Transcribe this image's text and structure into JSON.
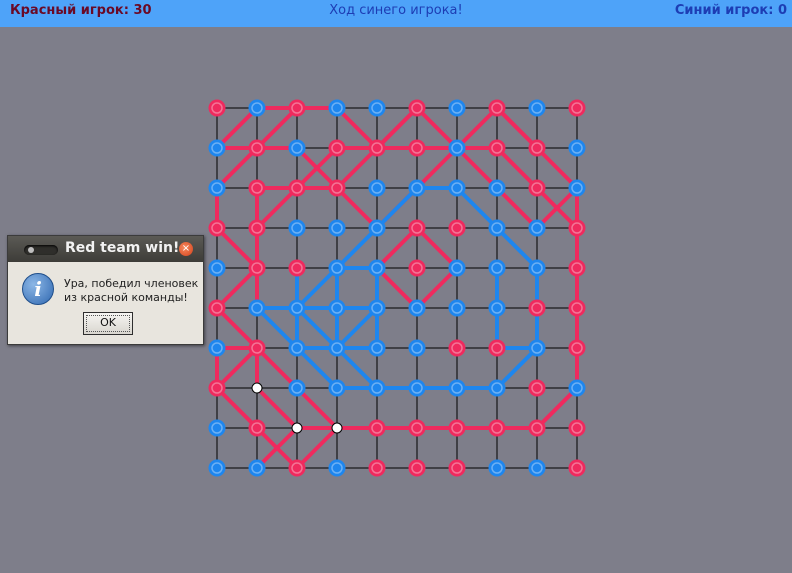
{
  "header": {
    "red_score": "Красный игрок: 30",
    "status": "Ход синего игрока!",
    "blue_score": "Синий игрок: 0"
  },
  "colors": {
    "red": "#ef2a5e",
    "blue": "#1e86ee",
    "grid": "#000000",
    "background": "#7e7e8a",
    "topbar": "#4ea3f9"
  },
  "board": {
    "size": 10,
    "dots": [
      "RBRBBRBRBR",
      "BRBRRRBRRB",
      "BRRRBBBBRB",
      "RRBBBRRBBR",
      "BRRBBRBBBR",
      "RBBBBBBBRR",
      "BRBBBBRRBR",
      "ROBBBBBBRB",
      "BRObRRRRRR",
      "BBRBRRRBBR"
    ],
    "red_lines": [
      [
        [
          0,
          1
        ],
        [
          1,
          0
        ],
        [
          2,
          0
        ],
        [
          3,
          0
        ],
        [
          4,
          1
        ],
        [
          5,
          0
        ],
        [
          6,
          1
        ],
        [
          7,
          0
        ],
        [
          8,
          1
        ]
      ],
      [
        [
          0,
          1
        ],
        [
          1,
          1
        ],
        [
          2,
          1
        ],
        [
          3,
          2
        ],
        [
          4,
          3
        ],
        [
          5,
          2
        ],
        [
          6,
          1
        ],
        [
          7,
          2
        ],
        [
          8,
          3
        ],
        [
          9,
          2
        ],
        [
          10,
          3
        ],
        [
          11,
          2
        ]
      ],
      [
        [
          1,
          3
        ],
        [
          2,
          2
        ],
        [
          3,
          1
        ],
        [
          4,
          1
        ],
        [
          5,
          1
        ],
        [
          6,
          1
        ],
        [
          7,
          1
        ],
        [
          8,
          2
        ],
        [
          9,
          3
        ]
      ],
      [
        [
          2,
          0
        ],
        [
          1,
          1
        ],
        [
          0,
          2
        ],
        [
          0,
          3
        ],
        [
          1,
          4
        ],
        [
          0,
          5
        ],
        [
          1,
          6
        ],
        [
          1,
          7
        ],
        [
          2,
          8
        ],
        [
          1,
          9
        ]
      ],
      [
        [
          4,
          1
        ],
        [
          3,
          2
        ],
        [
          2,
          2
        ],
        [
          1,
          2
        ]
      ],
      [
        [
          1,
          2
        ],
        [
          1,
          3
        ],
        [
          1,
          4
        ],
        [
          1,
          5
        ]
      ],
      [
        [
          5,
          0
        ],
        [
          4,
          1
        ]
      ],
      [
        [
          7,
          0
        ],
        [
          8,
          1
        ],
        [
          9,
          2
        ],
        [
          9,
          3
        ],
        [
          9,
          4
        ],
        [
          9,
          5
        ],
        [
          9,
          6
        ],
        [
          9,
          7
        ],
        [
          8,
          8
        ],
        [
          7,
          8
        ],
        [
          6,
          8
        ],
        [
          5,
          8
        ],
        [
          4,
          8
        ],
        [
          3,
          8
        ],
        [
          2,
          8
        ]
      ],
      [
        [
          5,
          3
        ],
        [
          4,
          4
        ],
        [
          5,
          5
        ],
        [
          6,
          4
        ],
        [
          5,
          3
        ]
      ],
      [
        [
          0,
          6
        ],
        [
          1,
          6
        ],
        [
          2,
          7
        ],
        [
          3,
          8
        ],
        [
          2,
          9
        ],
        [
          1,
          8
        ],
        [
          0,
          7
        ],
        [
          0,
          6
        ]
      ],
      [
        [
          1,
          6
        ],
        [
          0,
          7
        ]
      ],
      [
        [
          8,
          8
        ],
        [
          9,
          7
        ]
      ]
    ],
    "blue_lines": [
      [
        [
          5,
          2
        ],
        [
          6,
          2
        ],
        [
          7,
          3
        ],
        [
          8,
          4
        ],
        [
          8,
          5
        ],
        [
          8,
          6
        ],
        [
          7,
          7
        ],
        [
          6,
          7
        ],
        [
          5,
          7
        ],
        [
          4,
          7
        ],
        [
          3,
          6
        ],
        [
          2,
          5
        ],
        [
          3,
          4
        ],
        [
          4,
          3
        ],
        [
          5,
          2
        ]
      ],
      [
        [
          1,
          5
        ],
        [
          2,
          5
        ],
        [
          3,
          5
        ],
        [
          4,
          5
        ],
        [
          4,
          6
        ],
        [
          3,
          6
        ],
        [
          2,
          6
        ],
        [
          1,
          5
        ]
      ],
      [
        [
          2,
          4
        ],
        [
          2,
          5
        ],
        [
          2,
          6
        ],
        [
          3,
          7
        ],
        [
          4,
          7
        ]
      ],
      [
        [
          3,
          4
        ],
        [
          3,
          5
        ],
        [
          3,
          6
        ],
        [
          4,
          5
        ],
        [
          4,
          4
        ],
        [
          3,
          4
        ]
      ],
      [
        [
          7,
          4
        ],
        [
          7,
          5
        ],
        [
          7,
          6
        ],
        [
          8,
          6
        ]
      ]
    ]
  }
}
